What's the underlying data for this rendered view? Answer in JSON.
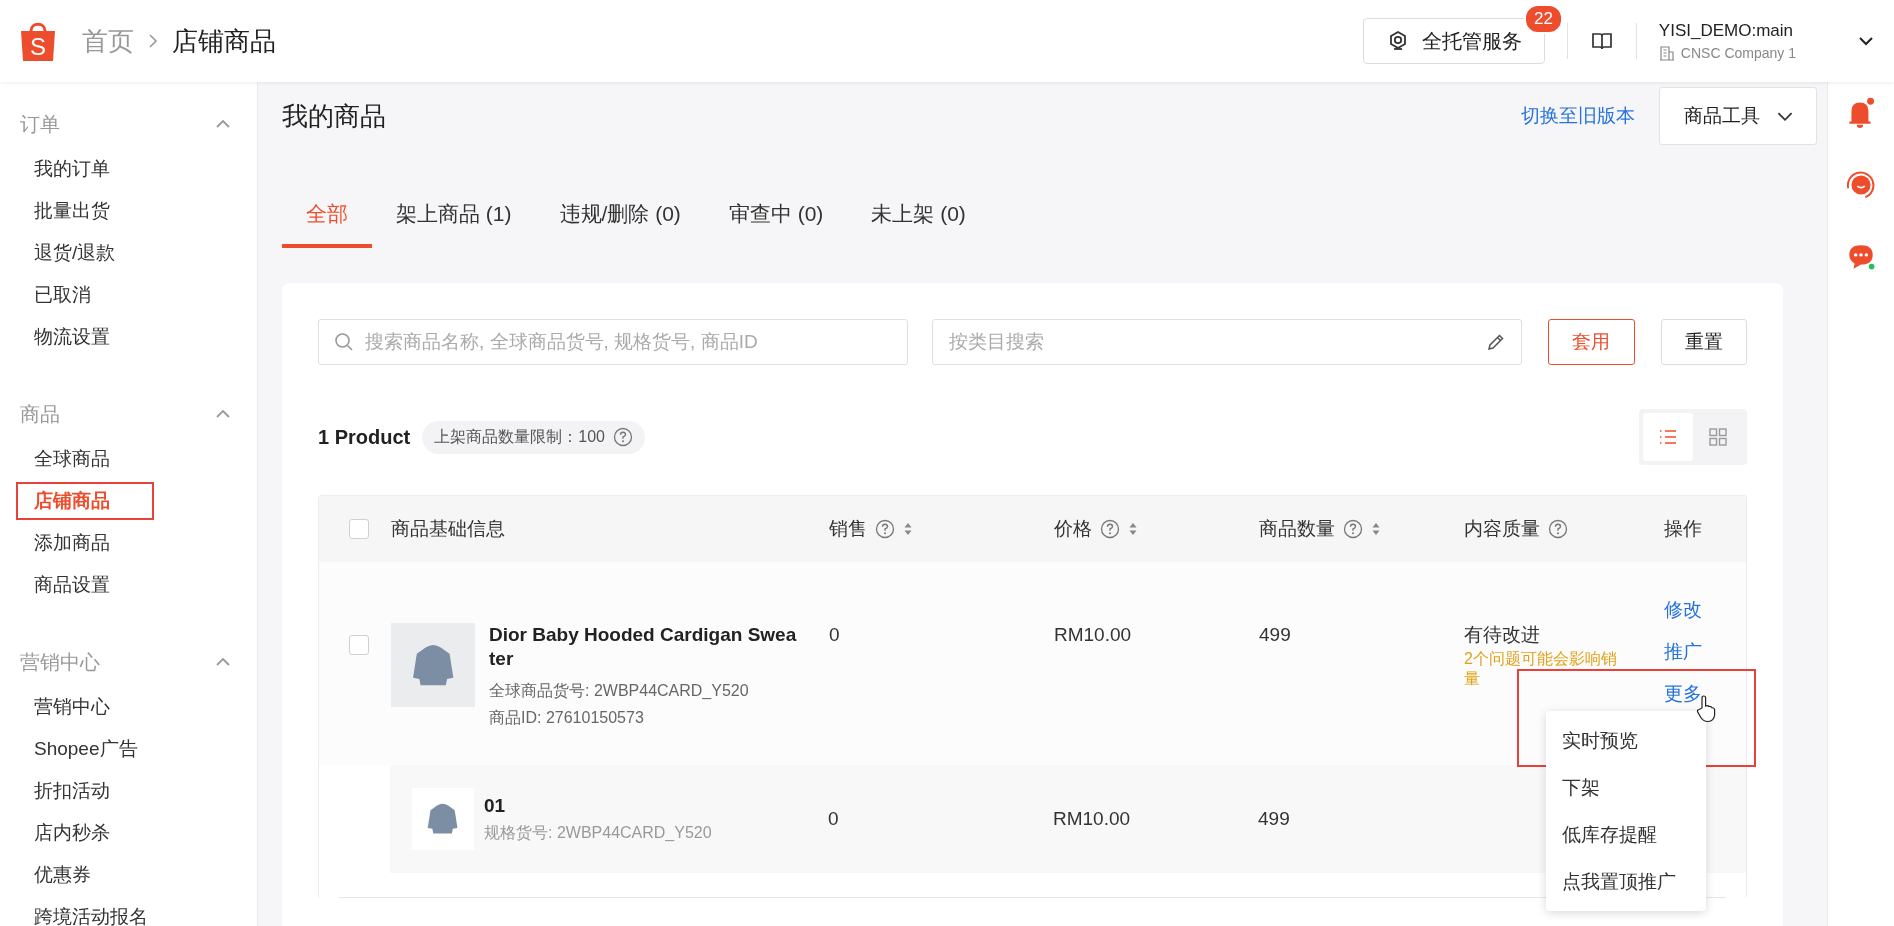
{
  "header": {
    "logo_letter": "S",
    "breadcrumb": [
      {
        "label": "首页",
        "current": false
      },
      {
        "label": "店铺商品",
        "current": true
      }
    ],
    "service_button": {
      "label": "全托管服务",
      "badge": "22"
    },
    "account": {
      "name": "YISI_DEMO:main",
      "company": "CNSC Company 1"
    }
  },
  "sidebar": [
    {
      "title": "订单",
      "expanded": true,
      "items": [
        {
          "label": "我的订单",
          "selected": false
        },
        {
          "label": "批量出货",
          "selected": false
        },
        {
          "label": "退货/退款",
          "selected": false
        },
        {
          "label": "已取消",
          "selected": false
        },
        {
          "label": "物流设置",
          "selected": false
        }
      ]
    },
    {
      "title": "商品",
      "expanded": true,
      "items": [
        {
          "label": "全球商品",
          "selected": false
        },
        {
          "label": "店铺商品",
          "selected": true
        },
        {
          "label": "添加商品",
          "selected": false
        },
        {
          "label": "商品设置",
          "selected": false
        }
      ]
    },
    {
      "title": "营销中心",
      "expanded": true,
      "items": [
        {
          "label": "营销中心",
          "selected": false
        },
        {
          "label": "Shopee广告",
          "selected": false
        },
        {
          "label": "折扣活动",
          "selected": false
        },
        {
          "label": "店内秒杀",
          "selected": false
        },
        {
          "label": "优惠券",
          "selected": false
        },
        {
          "label": "跨境活动报名",
          "selected": false
        }
      ]
    }
  ],
  "page": {
    "title": "我的商品",
    "switch_link": "切换至旧版本",
    "tools_button": "商品工具"
  },
  "tabs": [
    {
      "label": "全部",
      "selected": true
    },
    {
      "label": "架上商品 (1)",
      "selected": false
    },
    {
      "label": "违规/删除 (0)",
      "selected": false
    },
    {
      "label": "审查中 (0)",
      "selected": false
    },
    {
      "label": "未上架 (0)",
      "selected": false
    }
  ],
  "filters": {
    "search_placeholder": "搜索商品名称, 全球商品货号, 规格货号, 商品ID",
    "category_placeholder": "按类目搜索",
    "apply": "套用",
    "reset": "重置"
  },
  "summary": {
    "count": "1 Product",
    "limit": "上架商品数量限制：100"
  },
  "view_toggle": [
    {
      "kind": "list",
      "selected": true
    },
    {
      "kind": "grid",
      "selected": false
    }
  ],
  "table": {
    "select_all_checked": false,
    "columns": [
      {
        "label": "商品基础信息",
        "help": false,
        "sortable": false
      },
      {
        "label": "销售",
        "help": true,
        "sortable": true
      },
      {
        "label": "价格",
        "help": true,
        "sortable": true
      },
      {
        "label": "商品数量",
        "help": true,
        "sortable": true
      },
      {
        "label": "内容质量",
        "help": true,
        "sortable": false
      },
      {
        "label": "操作",
        "help": false,
        "sortable": false
      }
    ],
    "product": {
      "checked": false,
      "name": "Dior Baby Hooded Cardigan Sweater",
      "global_sku": "全球商品货号: 2WBP44CARD_Y520",
      "product_id": "商品ID: 27610150573",
      "sales": "0",
      "price": "RM10.00",
      "stock": "499",
      "quality": "有待改进",
      "quality_note": "2个问题可能会影响销量",
      "actions": [
        "修改",
        "推广",
        "更多"
      ]
    },
    "variations": [
      {
        "name": "01",
        "sku": "规格货号: 2WBP44CARD_Y520",
        "sales": "0",
        "price": "RM10.00",
        "stock": "499"
      }
    ]
  },
  "more_menu": [
    "实时预览",
    "下架",
    "低库存提醒",
    "点我置顶推广"
  ]
}
